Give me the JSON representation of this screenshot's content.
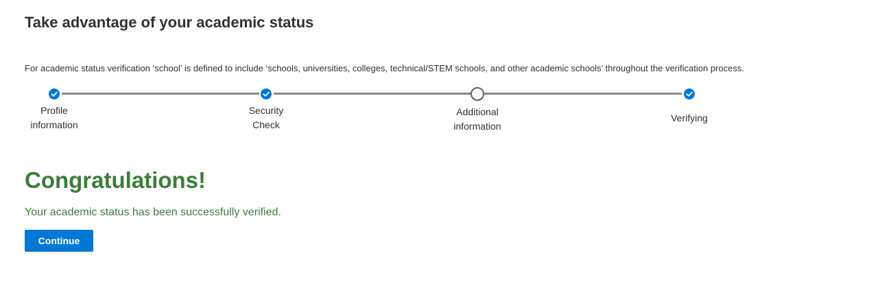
{
  "header": {
    "title": "Take advantage of your academic status"
  },
  "disclaimer": "For academic status verification ‘school’ is defined to include ‘schools, universities, colleges, technical/STEM schools, and other academic schools’ throughout the verification process.",
  "stepper": {
    "steps": [
      {
        "label_line1": "Profile",
        "label_line2": "information",
        "status": "complete",
        "icon": "checkmark-icon"
      },
      {
        "label_line1": "Security",
        "label_line2": "Check",
        "status": "complete",
        "icon": "checkmark-icon"
      },
      {
        "label_line1": "Additional",
        "label_line2": "information",
        "status": "incomplete",
        "icon": "empty-circle-icon"
      },
      {
        "label_line1": "Verifying",
        "label_line2": "",
        "status": "complete",
        "icon": "checkmark-icon"
      }
    ]
  },
  "result": {
    "heading": "Congratulations!",
    "message": "Your academic status has been successfully verified."
  },
  "actions": {
    "continue_label": "Continue"
  },
  "colors": {
    "accent": "#0078d4",
    "success": "#3a7d3a",
    "connector": "#8a8886"
  }
}
